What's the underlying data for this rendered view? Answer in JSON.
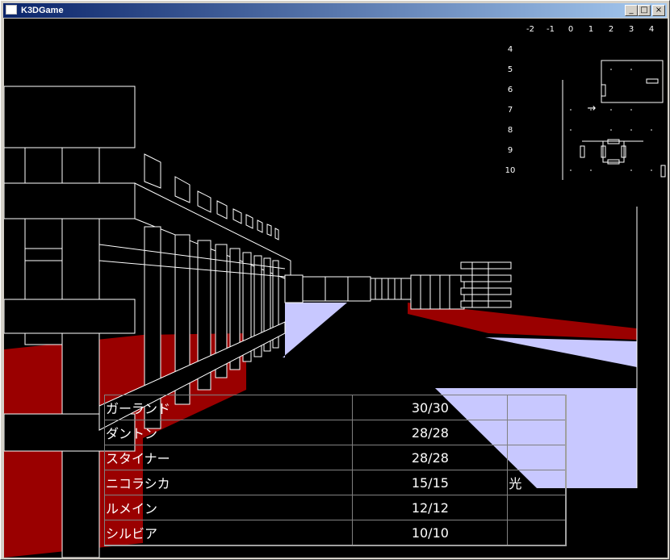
{
  "window": {
    "title": "K3DGame",
    "minimize_glyph": "_",
    "maximize_glyph": "□",
    "close_glyph": "×"
  },
  "minimap": {
    "columns": [
      "-2",
      "-1",
      "0",
      "1",
      "2",
      "3",
      "4"
    ],
    "rows": [
      "4",
      "5",
      "6",
      "7",
      "8",
      "9",
      "10"
    ],
    "player_marker": "→"
  },
  "party": [
    {
      "name": "ガーランド",
      "hp": "30/30",
      "status": ""
    },
    {
      "name": "ダントン",
      "hp": "28/28",
      "status": ""
    },
    {
      "name": "スタイナー",
      "hp": "28/28",
      "status": ""
    },
    {
      "name": "ニコラシカ",
      "hp": "15/15",
      "status": "光"
    },
    {
      "name": "ルメイン",
      "hp": "12/12",
      "status": ""
    },
    {
      "name": "シルビア",
      "hp": "10/10",
      "status": ""
    }
  ],
  "colors": {
    "floor_red": "#9a0000",
    "floor_lavender": "#c8c8ff",
    "wire": "#ffffff",
    "background": "#000000"
  }
}
